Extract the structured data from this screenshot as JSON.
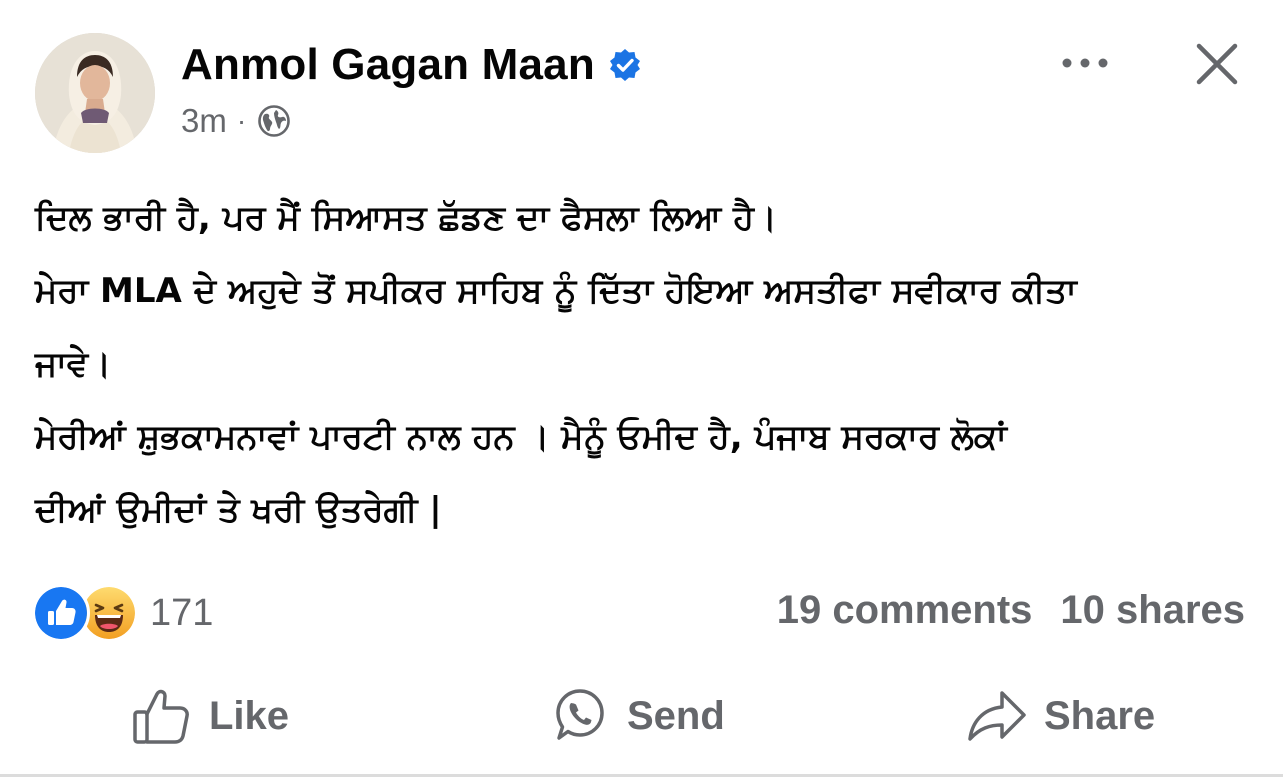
{
  "author": {
    "name": "Anmol Gagan Maan",
    "verified": true,
    "verified_icon": "verified-badge-icon",
    "time": "3m",
    "separator": "·",
    "audience_icon": "globe-icon"
  },
  "header_actions": {
    "more_icon": "more-horizontal-icon",
    "close_icon": "close-icon"
  },
  "post": {
    "lines": [
      "ਦਿਲ ਭਾਰੀ ਹੈ, ਪਰ ਮੈਂ ਸਿਆਸਤ ਛੱਡਣ ਦਾ ਫੈਸਲਾ ਲਿਆ ਹੈ।",
      "ਮੇਰਾ MLA ਦੇ ਅਹੁਦੇ ਤੋਂ ਸਪੀਕਰ ਸਾਹਿਬ ਨੂੰ ਦਿੱਤਾ ਹੋਇਆ ਅਸਤੀਫਾ ਸਵੀਕਾਰ ਕੀਤਾ",
      "ਜਾਵੇ।",
      "ਮੇਰੀਆਂ ਸ਼ੁਭਕਾਮਨਾਵਾਂ ਪਾਰਟੀ ਨਾਲ ਹਨ । ਮੈਨੂੰ ਓਮੀਦ ਹੈ,  ਪੰਜਾਬ ਸਰਕਾਰ ਲੋਕਾਂ",
      "ਦੀਆਂ ਉਮੀਦਾਂ ਤੇ ਖਰੀ ਉਤਰੇਗੀ |"
    ]
  },
  "reactions": {
    "icons": [
      "like-reaction-icon",
      "haha-reaction-icon"
    ],
    "count": "171"
  },
  "stats": {
    "comments": "19 comments",
    "shares": "10 shares"
  },
  "actions": {
    "like_label": "Like",
    "send_label": "Send",
    "share_label": "Share"
  },
  "colors": {
    "text": "#050505",
    "secondary": "#65676b",
    "verified_blue": "#1b74e4",
    "like_blue": "#1877f2",
    "haha_yellow": "#f7b125"
  }
}
